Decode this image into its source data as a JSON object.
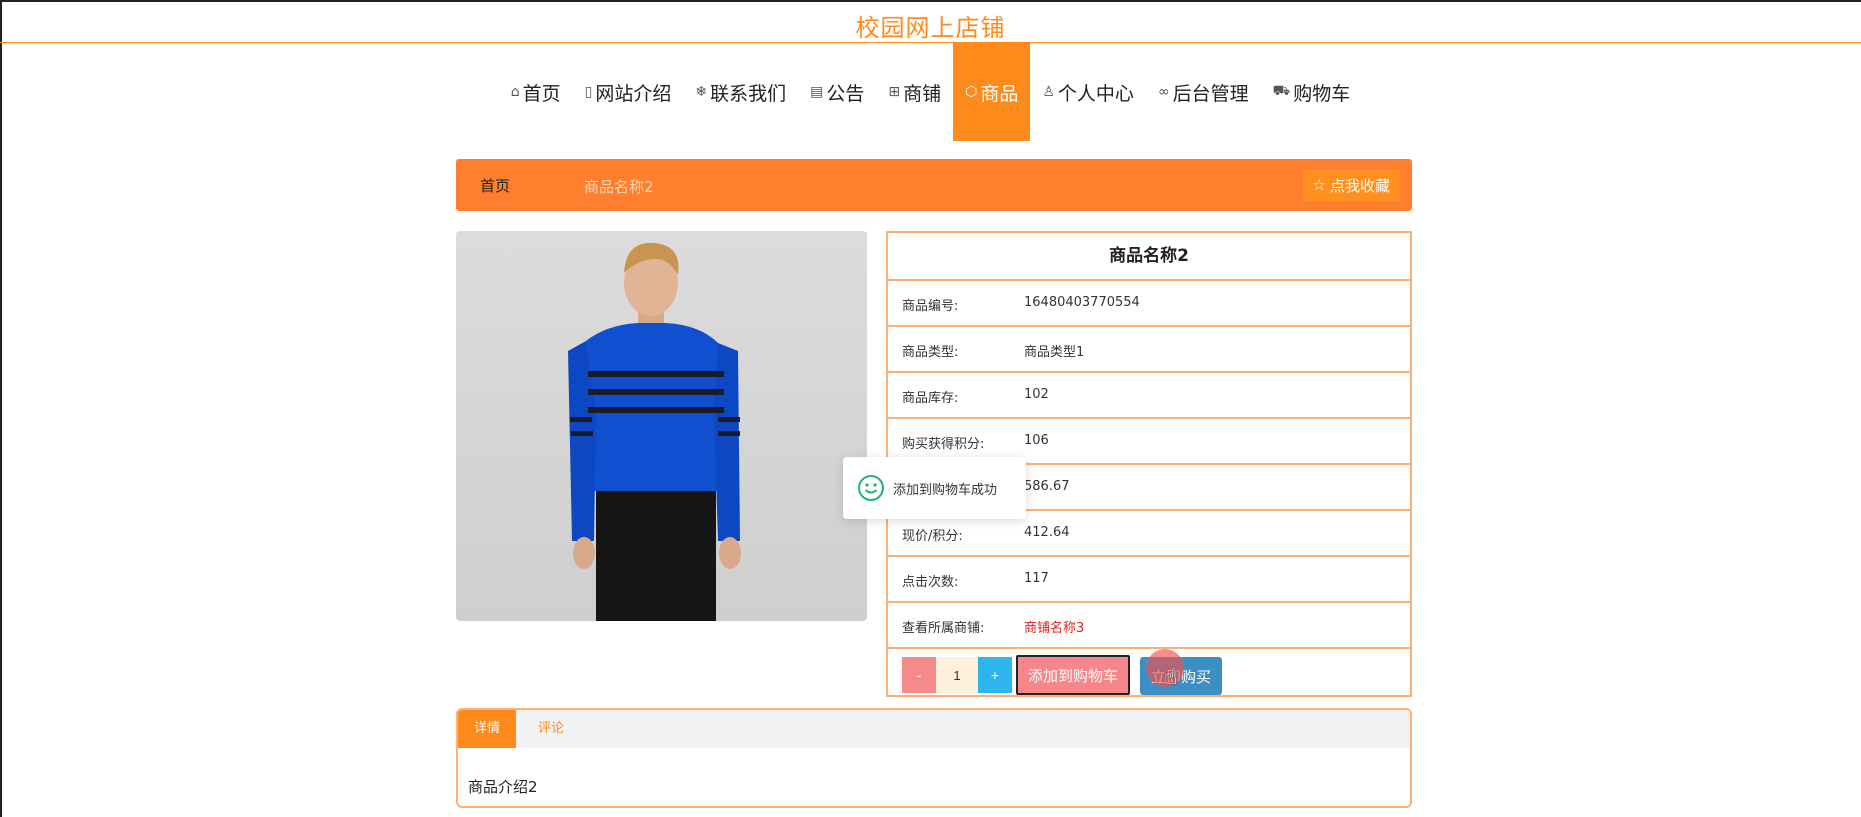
{
  "header": {
    "site_title": "校园网上店铺"
  },
  "nav": {
    "items": [
      {
        "label": "首页",
        "icon": "home-icon",
        "glyph": "⌂"
      },
      {
        "label": "网站介绍",
        "icon": "doc-icon",
        "glyph": "▯"
      },
      {
        "label": "联系我们",
        "icon": "snowflake-icon",
        "glyph": "❄"
      },
      {
        "label": "公告",
        "icon": "clipboard-icon",
        "glyph": "▤"
      },
      {
        "label": "商铺",
        "icon": "grid-icon",
        "glyph": "⊞"
      },
      {
        "label": "商品",
        "icon": "tag-icon",
        "glyph": "⬡",
        "active": true
      },
      {
        "label": "个人中心",
        "icon": "user-icon",
        "glyph": "♙"
      },
      {
        "label": "后台管理",
        "icon": "link-icon",
        "glyph": "∞"
      },
      {
        "label": "购物车",
        "icon": "cart-icon",
        "glyph": "⛟"
      }
    ]
  },
  "breadcrumb": {
    "home": "首页",
    "current": "商品名称2"
  },
  "favorite": {
    "icon": "star-icon",
    "glyph": "☆",
    "label": "点我收藏"
  },
  "product": {
    "title": "商品名称2",
    "fields": [
      {
        "label": "商品编号:",
        "value": "16480403770554"
      },
      {
        "label": "商品类型:",
        "value": "商品类型1"
      },
      {
        "label": "商品库存:",
        "value": "102"
      },
      {
        "label": "购买获得积分:",
        "value": "106"
      },
      {
        "label": "",
        "value": "586.67"
      },
      {
        "label": "现价/积分:",
        "value": "412.64"
      },
      {
        "label": "点击次数:",
        "value": "117"
      },
      {
        "label": "查看所属商铺:",
        "value": "商铺名称3",
        "link": true
      }
    ],
    "quantity": {
      "minus": "-",
      "value": "1",
      "plus": "+"
    },
    "add_cart_label": "添加到购物车",
    "buy_label": "立即购买"
  },
  "toast": {
    "text": "添加到购物车成功",
    "icon": "smile-icon"
  },
  "tabs": {
    "items": [
      "详情",
      "评论"
    ],
    "active": 0,
    "content": "商品介绍2"
  },
  "colors": {
    "accent": "#ff8a1c",
    "crumb_bar": "#ff7f2e",
    "border": "#ffb173",
    "link_red": "#e02020",
    "sweater_blue": "#0f4fd0"
  }
}
